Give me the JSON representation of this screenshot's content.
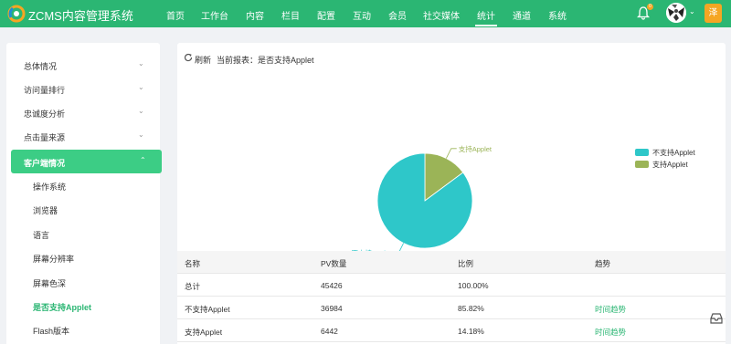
{
  "app": {
    "brand": "ZCMS内容管理系统",
    "nav": [
      "首页",
      "工作台",
      "内容",
      "栏目",
      "配置",
      "互动",
      "会员",
      "社交媒体",
      "统计",
      "通道",
      "系统"
    ],
    "active_nav": "统计",
    "notification_count": "0",
    "user_chip": "泽",
    "colors": {
      "header": "#2bb673",
      "accent": "#3ccd85",
      "chip": "#f5a623"
    }
  },
  "sidebar": {
    "groups": [
      {
        "label": "总体情况",
        "icon": "chevron-down-icon"
      },
      {
        "label": "访问量排行",
        "icon": "chevron-down-icon"
      },
      {
        "label": "忠诚度分析",
        "icon": "chevron-down-icon"
      },
      {
        "label": "点击量来源",
        "icon": "chevron-down-icon"
      },
      {
        "label": "客户端情况",
        "icon": "chevron-up-icon"
      }
    ],
    "subitems": [
      "操作系统",
      "浏览器",
      "语言",
      "屏幕分辨率",
      "屏幕色深",
      "是否支持Applet",
      "Flash版本"
    ],
    "current_subitem": "是否支持Applet"
  },
  "toolbar": {
    "refresh_label": "刷新",
    "report_label": "当前报表：是否支持Applet"
  },
  "chart_data": {
    "type": "pie",
    "categories": [
      "不支持Applet",
      "支持Applet"
    ],
    "values": [
      36984,
      6442
    ],
    "colors": [
      "#2ec7c9",
      "#9bb457"
    ],
    "slice_labels": [
      "不支持Applet",
      "支持Applet"
    ],
    "legend": [
      "不支持Applet",
      "支持Applet"
    ],
    "legend_position": "right"
  },
  "table": {
    "headers": [
      "名称",
      "PV数量",
      "比例",
      "趋势"
    ],
    "rows": [
      [
        "总计",
        "45426",
        "100.00%",
        ""
      ],
      [
        "不支持Applet",
        "36984",
        "85.82%",
        "时间趋势"
      ],
      [
        "支持Applet",
        "6442",
        "14.18%",
        "时间趋势"
      ]
    ]
  }
}
